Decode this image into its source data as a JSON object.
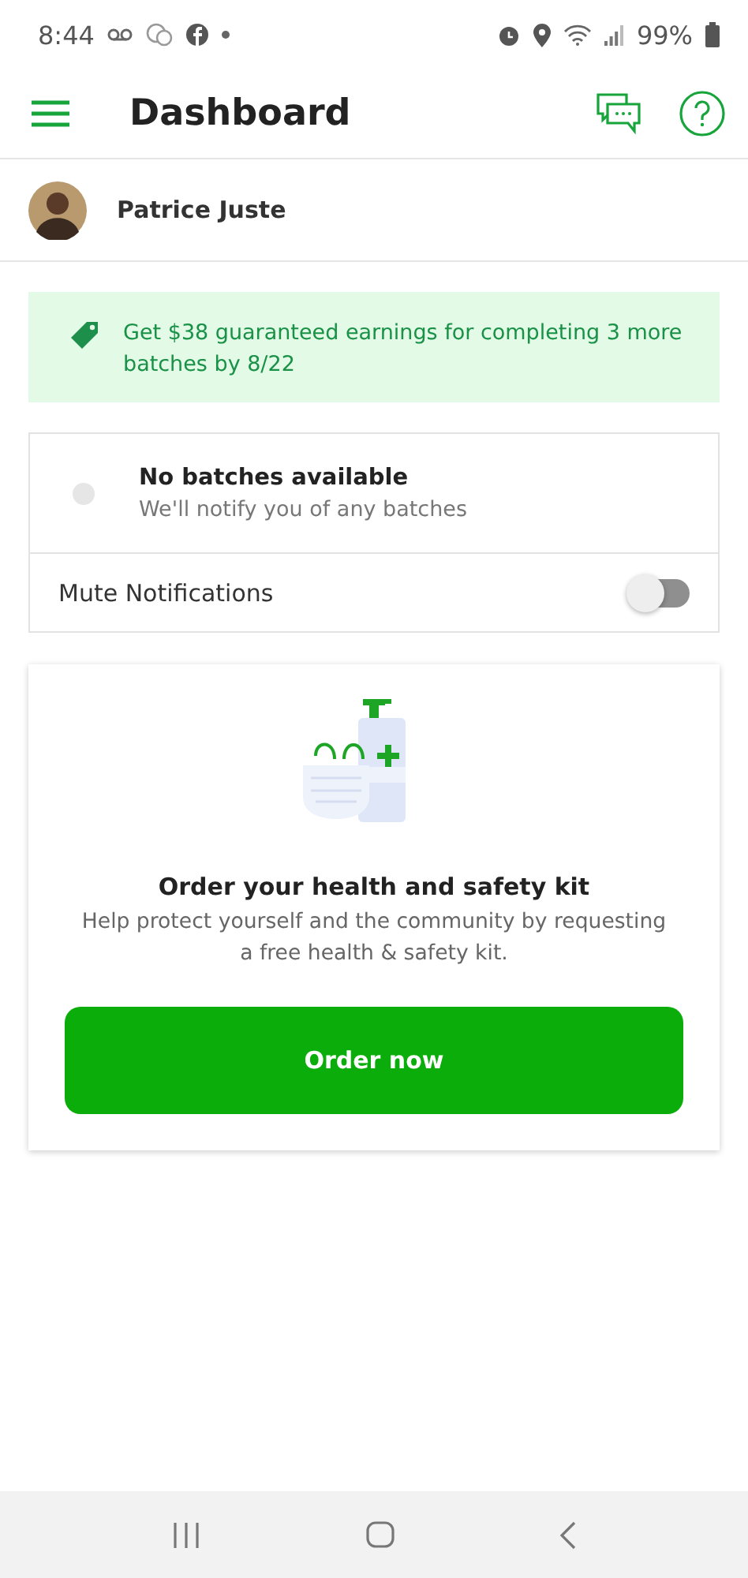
{
  "status_bar": {
    "time": "8:44",
    "battery": "99%"
  },
  "header": {
    "title": "Dashboard"
  },
  "user": {
    "name": "Patrice Juste"
  },
  "promo": {
    "text": "Get $38 guaranteed earnings for completing 3 more batches by 8/22"
  },
  "batches": {
    "title": "No batches available",
    "subtitle": "We'll notify you of any batches"
  },
  "mute": {
    "label": "Mute Notifications",
    "on": false
  },
  "kit": {
    "title": "Order your health and safety kit",
    "text": "Help protect yourself and the community by requesting a free health & safety kit.",
    "button": "Order now"
  }
}
